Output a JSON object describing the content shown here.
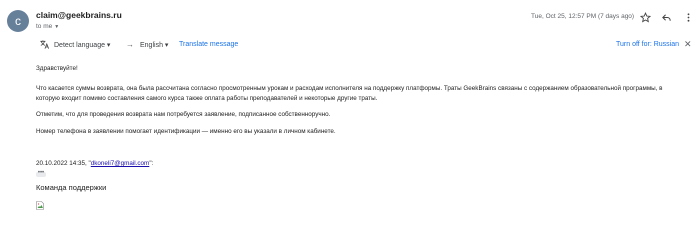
{
  "header": {
    "avatar_letter": "c",
    "sender": "claim@geekbrains.ru",
    "to_me": "to me",
    "date": "Tue, Oct 25, 12:57 PM (7 days ago)"
  },
  "translate": {
    "detect_label": "Detect language",
    "target_language": "English",
    "translate_link": "Translate message",
    "turn_off": "Turn off for: Russian"
  },
  "body": {
    "greeting": "Здравствуйте!",
    "paragraph1": "Что касается суммы возврата, она была рассчитана согласно просмотренным урокам и расходам исполнителя на поддержку платформы. Траты GeekBrains связаны с содержанием образовательной программы, в которую входит помимо составления самого курса также оплата работы преподавателей и некоторые другие траты.",
    "paragraph2": "Отметим, что для проведения возврата нам потребуется  заявление, подписанное собственноручно.",
    "paragraph3": "Номер телефона в заявлении помогает идентификации — именно его вы указали в личном кабинете."
  },
  "quote": {
    "prefix": "20.10.2022 14:35, \"",
    "email": "dkoneli7@gmail.com",
    "suffix": "\":",
    "ellipsis": "•••"
  },
  "signature": {
    "team": "Команда поддержки"
  }
}
